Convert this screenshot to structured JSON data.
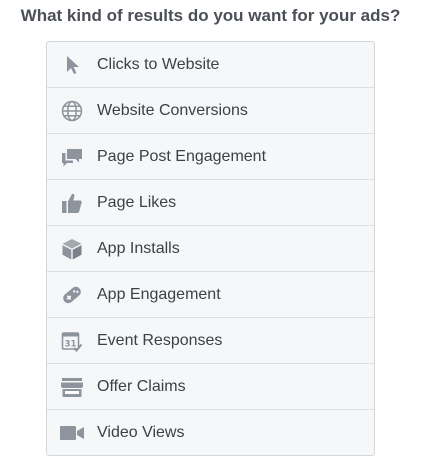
{
  "heading": "What kind of results do you want for your ads?",
  "colors": {
    "icon": "#8d949e",
    "text": "#3c4047",
    "heading": "#4b4f56",
    "border": "#dddfe2",
    "background": "#f6f7f9"
  },
  "options": [
    {
      "label": "Clicks to Website",
      "icon": "cursor-icon"
    },
    {
      "label": "Website Conversions",
      "icon": "globe-icon"
    },
    {
      "label": "Page Post Engagement",
      "icon": "speech-bubbles-icon"
    },
    {
      "label": "Page Likes",
      "icon": "thumbs-up-icon"
    },
    {
      "label": "App Installs",
      "icon": "cube-icon"
    },
    {
      "label": "App Engagement",
      "icon": "gamepad-icon"
    },
    {
      "label": "Event Responses",
      "icon": "calendar-icon"
    },
    {
      "label": "Offer Claims",
      "icon": "storefront-icon"
    },
    {
      "label": "Video Views",
      "icon": "video-camera-icon"
    }
  ]
}
